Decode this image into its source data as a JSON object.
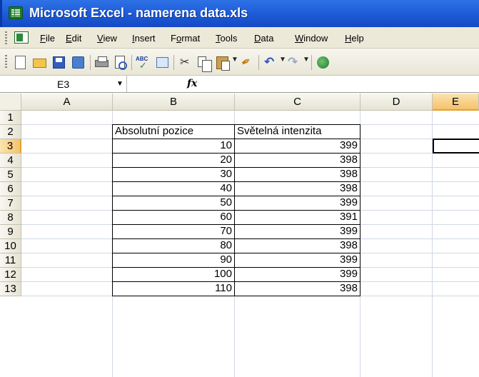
{
  "window": {
    "title": "Microsoft Excel - namerena data.xls"
  },
  "menu": {
    "items": [
      {
        "label": "File",
        "accel": "F",
        "rest": "ile"
      },
      {
        "label": "Edit",
        "accel": "E",
        "rest": "dit"
      },
      {
        "label": "View",
        "accel": "V",
        "rest": "iew"
      },
      {
        "label": "Insert",
        "accel": "I",
        "rest": "nsert"
      },
      {
        "label": "Format",
        "pre": "F",
        "accel": "o",
        "rest": "rmat"
      },
      {
        "label": "Tools",
        "accel": "T",
        "rest": "ools"
      },
      {
        "label": "Data",
        "accel": "D",
        "rest": "ata"
      },
      {
        "label": "Window",
        "accel": "W",
        "rest": "indow"
      },
      {
        "label": "Help",
        "accel": "H",
        "rest": "elp"
      }
    ]
  },
  "toolbar": {
    "buttons": [
      "new-icon",
      "open-icon",
      "save-icon",
      "permission-icon",
      "print-icon",
      "print-preview-icon",
      "spelling-icon",
      "research-icon",
      "cut-icon",
      "copy-icon",
      "paste-icon",
      "format-painter-icon",
      "undo-icon",
      "redo-icon",
      "hyperlink-icon"
    ],
    "spelling_label": "ABC"
  },
  "formula_bar": {
    "name_box": "E3",
    "fx_label": "fx",
    "formula": ""
  },
  "sheet": {
    "columns": [
      "A",
      "B",
      "C",
      "D",
      "E"
    ],
    "active_column": "E",
    "rows": [
      "1",
      "2",
      "3",
      "4",
      "5",
      "6",
      "7",
      "8",
      "9",
      "10",
      "11",
      "12",
      "13"
    ],
    "active_row": "3",
    "header_row": {
      "b": "Absolutní pozice",
      "c": "Světelná intenzita"
    },
    "data": [
      {
        "b": "10",
        "c": "399"
      },
      {
        "b": "20",
        "c": "398"
      },
      {
        "b": "30",
        "c": "398"
      },
      {
        "b": "40",
        "c": "398"
      },
      {
        "b": "50",
        "c": "399"
      },
      {
        "b": "60",
        "c": "391"
      },
      {
        "b": "70",
        "c": "399"
      },
      {
        "b": "80",
        "c": "398"
      },
      {
        "b": "90",
        "c": "399"
      },
      {
        "b": "100",
        "c": "399"
      },
      {
        "b": "110",
        "c": "398"
      }
    ],
    "selected_cell": "E3"
  },
  "colors": {
    "title_bar": "#1f5ed8",
    "chrome": "#ece9d8",
    "active_header": "#f5c26b",
    "gridline": "#d0d7e5"
  }
}
